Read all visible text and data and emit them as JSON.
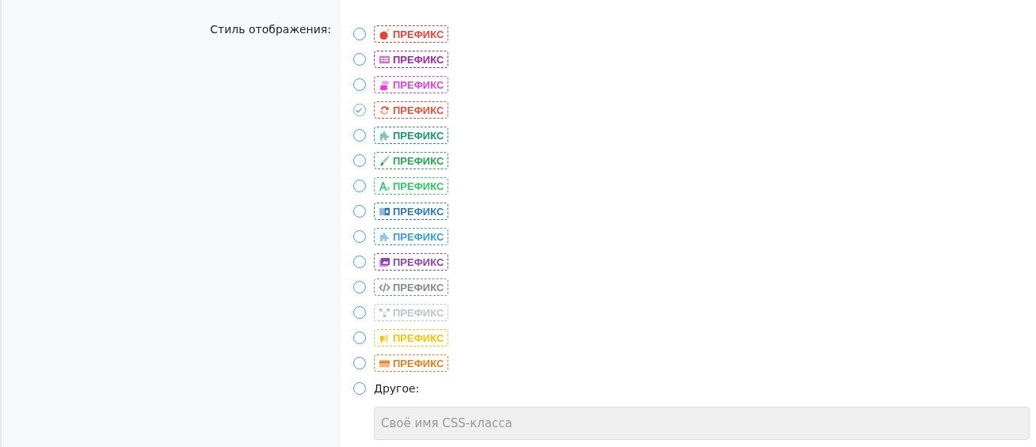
{
  "field": {
    "label": "Стиль отображения:",
    "options": [
      {
        "kind": "bomb",
        "label": "ПРЕФИКС",
        "color": "#e8413c",
        "selected": false
      },
      {
        "kind": "list",
        "label": "ПРЕФИКС",
        "color": "#9b27a6",
        "selected": false
      },
      {
        "kind": "coins",
        "label": "ПРЕФИКС",
        "color": "#e03fe0",
        "selected": false
      },
      {
        "kind": "refresh",
        "label": "ПРЕФИКС",
        "color": "#e0533f",
        "selected": true
      },
      {
        "kind": "puzzle",
        "label": "ПРЕФИКС",
        "color": "#17967a",
        "selected": false
      },
      {
        "kind": "brush",
        "label": "ПРЕФИКС",
        "color": "#27a554",
        "selected": false
      },
      {
        "kind": "font",
        "label": "ПРЕФИКС",
        "color": "#33c46c",
        "selected": false
      },
      {
        "kind": "translate",
        "label": "ПРЕФИКС",
        "color": "#2b78b5",
        "selected": false
      },
      {
        "kind": "puzzle",
        "label": "ПРЕФИКС",
        "color": "#3a9be0",
        "selected": false
      },
      {
        "kind": "image",
        "label": "ПРЕФИКС",
        "color": "#8e44ad",
        "selected": false
      },
      {
        "kind": "code",
        "label": "ПРЕФИКС",
        "color": "#7f8c8d",
        "selected": false
      },
      {
        "kind": "sitemap",
        "label": "ПРЕФИКС",
        "color": "#bdc3c7",
        "selected": false
      },
      {
        "kind": "megaphone",
        "label": "ПРЕФИКС",
        "color": "#f1c40f",
        "selected": false
      },
      {
        "kind": "card",
        "label": "ПРЕФИКС",
        "color": "#e67e22",
        "selected": false
      },
      {
        "kind": "other",
        "label": "Другое:",
        "selected": false,
        "placeholder": "Своё имя CSS-класса"
      }
    ]
  }
}
